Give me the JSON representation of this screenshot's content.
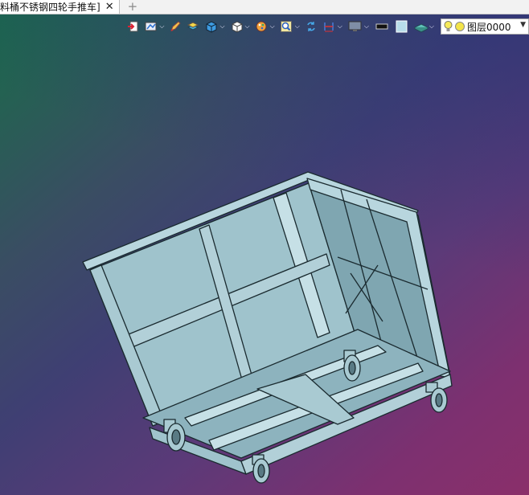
{
  "tab": {
    "title": "料桶不锈钢四轮手推车]",
    "close_glyph": "✕",
    "add_glyph": "+"
  },
  "toolbar": {
    "icons": [
      "exit-icon",
      "view-orient-icon",
      "pencil-icon",
      "stack-icon",
      "cube-shaded-icon",
      "cube-white-icon",
      "palette-icon",
      "zoom-fit-icon",
      "rotate-icon",
      "section-icon",
      "display-icon",
      "black-rect-icon",
      "light-rect-icon",
      "layer-plane-icon"
    ],
    "layer_label": "图层0000",
    "dropdown_glyph": "▼"
  },
  "colors": {
    "model_fill": "#9fc3cc",
    "model_stroke": "#1a2a2f",
    "accent_yellow": "#f3e44a"
  }
}
